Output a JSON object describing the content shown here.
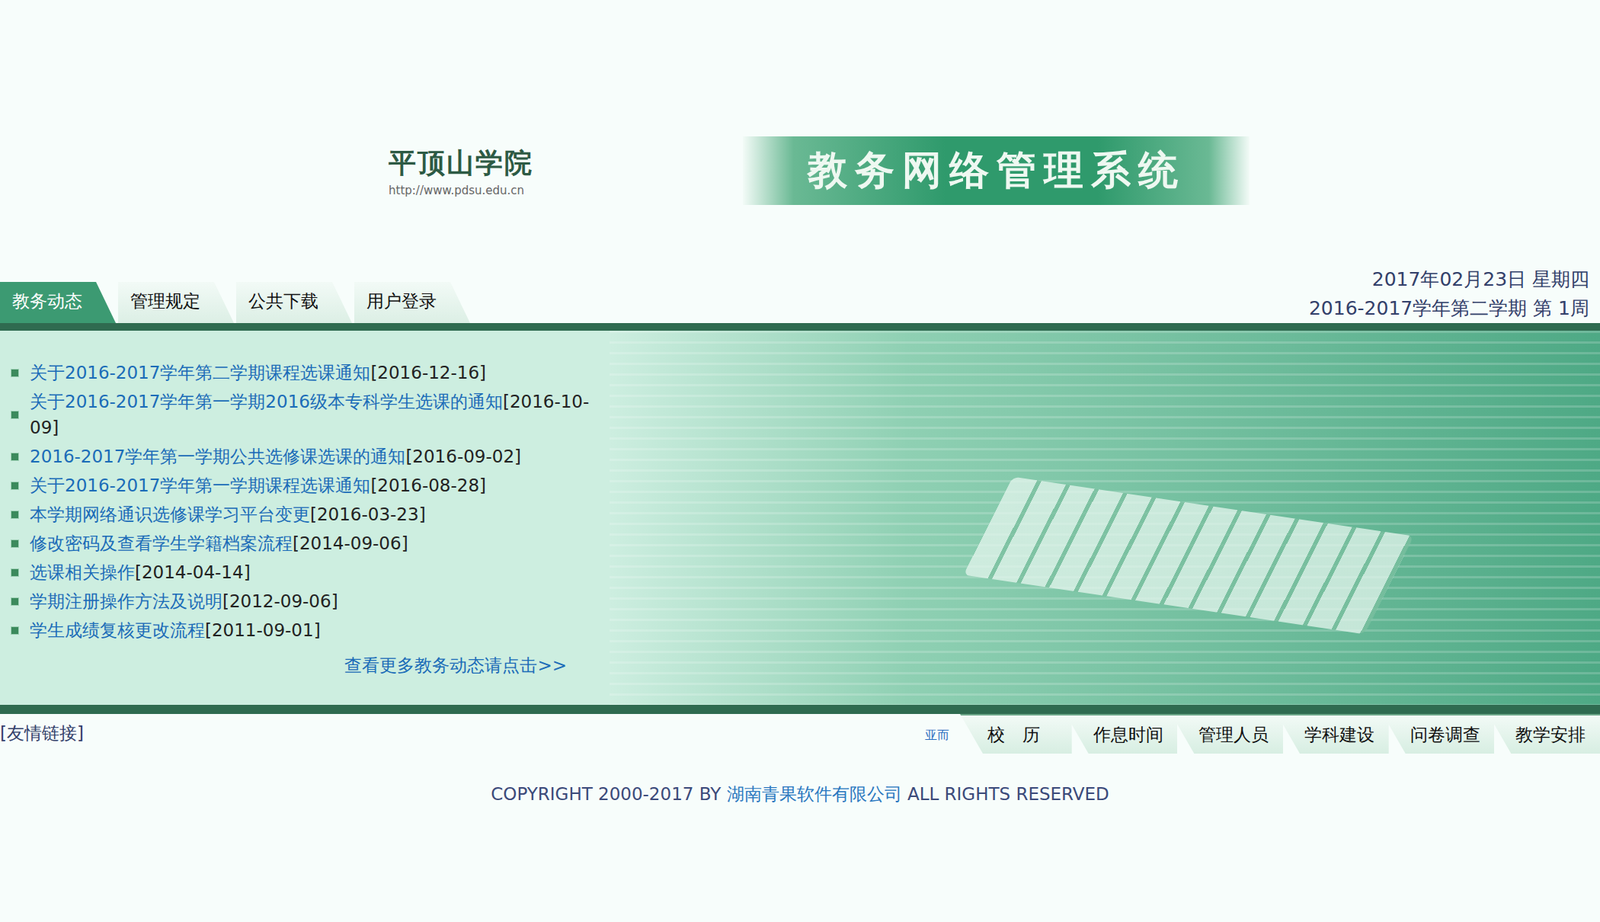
{
  "school": {
    "name": "平顶山学院",
    "url": "http://www.pdsu.edu.cn"
  },
  "system_title": "教务网络管理系统",
  "tabs": [
    {
      "label": "教务动态",
      "selected": true
    },
    {
      "label": "管理规定",
      "selected": false
    },
    {
      "label": "公共下载",
      "selected": false
    },
    {
      "label": "用户登录",
      "selected": false
    }
  ],
  "date": "2017年02月23日 星期四",
  "term": "2016-2017学年第二学期 第 1周",
  "news": [
    {
      "title": "关于2016-2017学年第二学期课程选课通知",
      "date": "[2016-12-16]"
    },
    {
      "title": "关于2016-2017学年第一学期2016级本专科学生选课的通知",
      "date": "[2016-10-09]"
    },
    {
      "title": "2016-2017学年第一学期公共选修课选课的通知",
      "date": "[2016-09-02]"
    },
    {
      "title": "关于2016-2017学年第一学期课程选课通知",
      "date": "[2016-08-28]"
    },
    {
      "title": "本学期网络通识选修课学习平台变更",
      "date": "[2016-03-23]"
    },
    {
      "title": "修改密码及查看学生学籍档案流程",
      "date": "[2014-09-06]"
    },
    {
      "title": "选课相关操作",
      "date": "[2014-04-14]"
    },
    {
      "title": "学期注册操作方法及说明",
      "date": "[2012-09-06]"
    },
    {
      "title": "学生成绩复核更改流程",
      "date": "[2011-09-01]"
    }
  ],
  "more_link": "查看更多教务动态请点击>>",
  "friend_links": "[友情链接]",
  "marquee": "亚而",
  "bottom_tabs": [
    "校　历",
    "作息时间",
    "管理人员",
    "学科建设",
    "问卷调查",
    "教学安排"
  ],
  "copyright": {
    "prefix": "COPYRIGHT 2000-2017 BY ",
    "company": "湖南青果软件有限公司",
    "suffix": " ALL RIGHTS RESERVED"
  }
}
